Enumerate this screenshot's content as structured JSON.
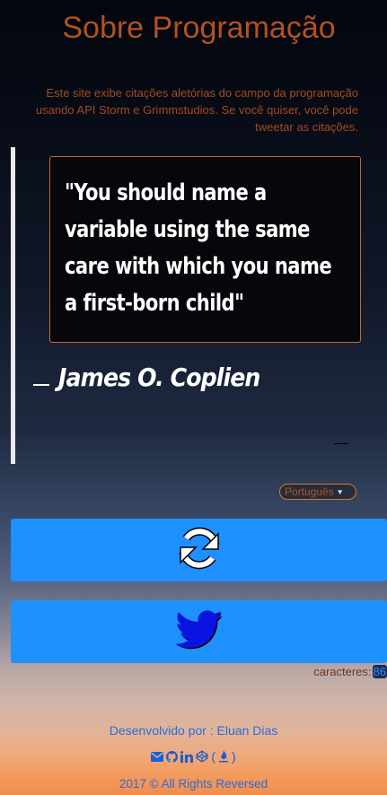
{
  "header": {
    "title": "Sobre Programação",
    "intro": "Este site exibe citações aletórias do campo da programação usando API Storm e Grimmstudios. Se você quiser, você pode tweetar as citações."
  },
  "quote": {
    "text": "\"You should name a variable using the same care with which you name a first-born child\"",
    "author": "James O. Coplien"
  },
  "language": {
    "selected": "Português"
  },
  "buttons": {
    "new_quote_icon": "refresh-icon",
    "tweet_icon": "twitter-icon"
  },
  "counter": {
    "label": "caracteres:",
    "value": "86"
  },
  "footer": {
    "developed_by": "Desenvolvido por : Eluan Dias",
    "social_open": "(",
    "social_close": ")",
    "copyright": "2017 © All Rights Reversed"
  },
  "colors": {
    "accent": "#b2521f",
    "button": "#1e90ff",
    "twitter_bird": "#0a14e0",
    "footer_link": "#2e6bd8"
  }
}
